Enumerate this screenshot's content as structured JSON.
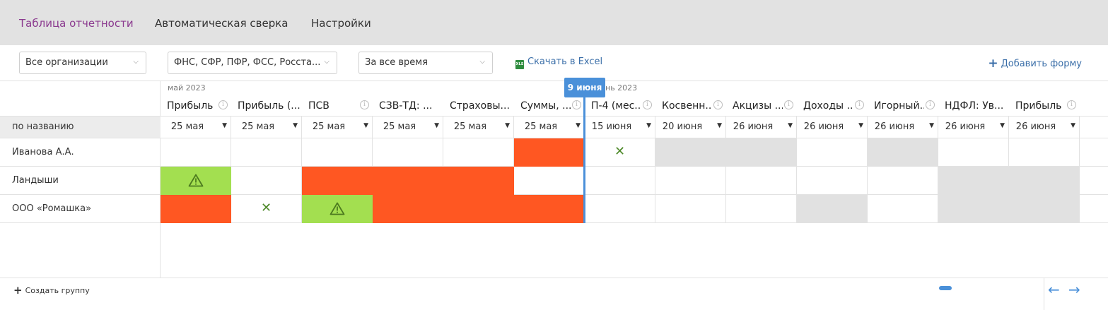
{
  "tabs": [
    {
      "label": "Таблица отчетности",
      "active": true
    },
    {
      "label": "Автоматическая сверка",
      "active": false
    },
    {
      "label": "Настройки",
      "active": false
    }
  ],
  "filters": {
    "organizations": "Все организации",
    "agencies": "ФНС, СФР, ПФР, ФСС, Росста...",
    "period": "За все время"
  },
  "actions": {
    "excel_icon": "XLS",
    "excel": "Скачать в Excel",
    "add_form": "Добавить форму"
  },
  "months": {
    "may": "май 2023",
    "june_partial": "нь 2023"
  },
  "today_label": "9 июня",
  "sort_label": "по названию",
  "columns": [
    {
      "title": "Прибыль",
      "info": true,
      "date": "25 мая"
    },
    {
      "title": "Прибыль (...",
      "info": false,
      "date": "25 мая"
    },
    {
      "title": "ПСВ",
      "info": true,
      "date": "25 мая"
    },
    {
      "title": "СЗВ-ТД: ...",
      "info": false,
      "date": "25 мая"
    },
    {
      "title": "Страховы...",
      "info": false,
      "date": "25 мая"
    },
    {
      "title": "Суммы, ...",
      "info": true,
      "date": "25 мая"
    },
    {
      "title": "П-4 (мес...",
      "info": true,
      "date": "15 июня"
    },
    {
      "title": "Косвенн...",
      "info": true,
      "date": "20 июня"
    },
    {
      "title": "Акцизы ...",
      "info": true,
      "date": "26 июня"
    },
    {
      "title": "Доходы ...",
      "info": true,
      "date": "26 июня"
    },
    {
      "title": "Игорный...",
      "info": true,
      "date": "26 июня"
    },
    {
      "title": "НДФЛ: Ув...",
      "info": false,
      "date": "26 июня"
    },
    {
      "title": "Прибыль",
      "info": true,
      "date": "26 июня"
    }
  ],
  "rows": [
    {
      "name": "Иванова А.А.",
      "cells": [
        "",
        "",
        "",
        "",
        "",
        "red",
        "x",
        "gray",
        "gray",
        "",
        "gray",
        "",
        ""
      ]
    },
    {
      "name": "Ландыши",
      "cells": [
        "green-warn",
        "",
        "red",
        "red",
        "red",
        "",
        "",
        "",
        "",
        "",
        "",
        "gray",
        "gray"
      ]
    },
    {
      "name": "ООО «Ромашка»",
      "cells": [
        "red",
        "x",
        "green-warn",
        "red",
        "red",
        "red",
        "",
        "",
        "",
        "gray",
        "",
        "gray",
        "gray"
      ]
    }
  ],
  "bottom": {
    "create_group": "Создать группу"
  },
  "colors": {
    "overdue": "#ff5722",
    "submitted": "#a3df50",
    "not_applicable": "#e1e1e1",
    "accent": "#4a90d9",
    "active_tab": "#8b3a8f"
  }
}
